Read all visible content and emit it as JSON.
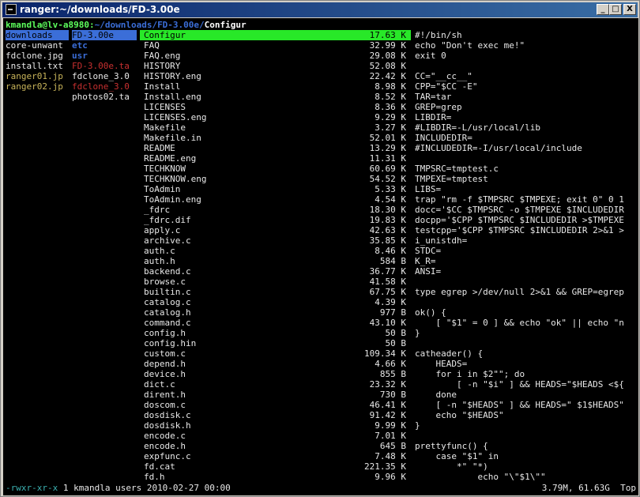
{
  "window": {
    "title": "ranger:~/downloads/FD-3.00e",
    "min": "_",
    "max": "□",
    "close": "X"
  },
  "header": {
    "user": "kmandla@lv-a8980:",
    "path": "~/downloads/FD-3.00e/",
    "file": "Configur"
  },
  "col1": [
    {
      "name": "downloads",
      "style": "sel-blue"
    },
    {
      "name": "core-unwant",
      "style": "white"
    },
    {
      "name": "fdclone.jpg",
      "style": "white"
    },
    {
      "name": "install.txt",
      "style": "white"
    },
    {
      "name": "ranger01.jp",
      "style": "yellow"
    },
    {
      "name": "ranger02.jp",
      "style": "yellow"
    }
  ],
  "col2": [
    {
      "name": "FD-3.00e",
      "style": "sel-blue"
    },
    {
      "name": "etc",
      "style": "blue"
    },
    {
      "name": "usr",
      "style": "blue"
    },
    {
      "name": "FD-3.00e.ta",
      "style": "red"
    },
    {
      "name": "fdclone_3.0",
      "style": "white"
    },
    {
      "name": "fdclone_3.0",
      "style": "red"
    },
    {
      "name": "photos02.ta",
      "style": "white"
    }
  ],
  "files": [
    {
      "name": "Configur",
      "size": "17.63 K"
    },
    {
      "name": "FAQ",
      "size": "32.99 K"
    },
    {
      "name": "FAQ.eng",
      "size": "29.08 K"
    },
    {
      "name": "HISTORY",
      "size": "52.08 K"
    },
    {
      "name": "HISTORY.eng",
      "size": "22.42 K"
    },
    {
      "name": "Install",
      "size": "8.98 K"
    },
    {
      "name": "Install.eng",
      "size": "8.52 K"
    },
    {
      "name": "LICENSES",
      "size": "8.36 K"
    },
    {
      "name": "LICENSES.eng",
      "size": "9.29 K"
    },
    {
      "name": "Makefile",
      "size": "3.27 K"
    },
    {
      "name": "Makefile.in",
      "size": "52.01 K"
    },
    {
      "name": "README",
      "size": "13.29 K"
    },
    {
      "name": "README.eng",
      "size": "11.31 K"
    },
    {
      "name": "TECHKNOW",
      "size": "60.69 K"
    },
    {
      "name": "TECHKNOW.eng",
      "size": "54.52 K"
    },
    {
      "name": "ToAdmin",
      "size": "5.33 K"
    },
    {
      "name": "ToAdmin.eng",
      "size": "4.54 K"
    },
    {
      "name": "_fdrc",
      "size": "18.30 K"
    },
    {
      "name": "_fdrc.dif",
      "size": "19.83 K"
    },
    {
      "name": "apply.c",
      "size": "42.63 K"
    },
    {
      "name": "archive.c",
      "size": "35.85 K"
    },
    {
      "name": "auth.c",
      "size": "8.46 K"
    },
    {
      "name": "auth.h",
      "size": "584 B"
    },
    {
      "name": "backend.c",
      "size": "36.77 K"
    },
    {
      "name": "browse.c",
      "size": "41.58 K"
    },
    {
      "name": "builtin.c",
      "size": "67.75 K"
    },
    {
      "name": "catalog.c",
      "size": "4.39 K"
    },
    {
      "name": "catalog.h",
      "size": "977 B"
    },
    {
      "name": "command.c",
      "size": "43.10 K"
    },
    {
      "name": "config.h",
      "size": "50 B"
    },
    {
      "name": "config.hin",
      "size": "50 B"
    },
    {
      "name": "custom.c",
      "size": "109.34 K"
    },
    {
      "name": "depend.h",
      "size": "4.66 K"
    },
    {
      "name": "device.h",
      "size": "855 B"
    },
    {
      "name": "dict.c",
      "size": "23.32 K"
    },
    {
      "name": "dirent.h",
      "size": "730 B"
    },
    {
      "name": "doscom.c",
      "size": "46.41 K"
    },
    {
      "name": "dosdisk.c",
      "size": "91.42 K"
    },
    {
      "name": "dosdisk.h",
      "size": "9.99 K"
    },
    {
      "name": "encode.c",
      "size": "7.01 K"
    },
    {
      "name": "encode.h",
      "size": "645 B"
    },
    {
      "name": "expfunc.c",
      "size": "7.48 K"
    },
    {
      "name": "fd.cat",
      "size": "221.35 K"
    },
    {
      "name": "fd.h",
      "size": "9.96 K"
    }
  ],
  "preview": [
    "#!/bin/sh",
    "echo \"Don't exec me!\"",
    "exit 0",
    "",
    "CC=\"__cc__\"",
    "CPP=\"$CC -E\"",
    "TAR=tar",
    "GREP=grep",
    "LIBDIR=",
    "#LIBDIR=-L/usr/local/lib",
    "INCLUDEDIR=",
    "#INCLUDEDIR=-I/usr/local/include",
    "",
    "TMPSRC=tmptest.c",
    "TMPEXE=tmptest",
    "LIBS=",
    "trap \"rm -f $TMPSRC $TMPEXE; exit 0\" 0 1",
    "docc='$CC $TMPSRC -o $TMPEXE $INCLUDEDIR",
    "docpp='$CPP $TMPSRC $INCLUDEDIR >$TMPEXE",
    "testcpp='$CPP $TMPSRC $INCLUDEDIR 2>&1 >",
    "i_unistdh=",
    "STDC=",
    "K_R=",
    "ANSI=",
    "",
    "type egrep >/dev/null 2>&1 && GREP=egrep",
    "",
    "ok() {",
    "    [ \"$1\" = 0 ] && echo \"ok\" || echo \"n",
    "}",
    "",
    "catheader() {",
    "    HEADS=",
    "    for i in $2\"\"; do",
    "        [ -n \"$i\" ] && HEADS=\"$HEADS <${",
    "    done",
    "    [ -n \"$HEADS\" ] && HEADS=\" $1$HEADS\"",
    "    echo \"$HEADS\"",
    "}",
    "",
    "prettyfunc() {",
    "    case \"$1\" in",
    "        *\" \"*)",
    "            echo \"\\\"$1\\\"\""
  ],
  "status": {
    "perm": "-rwxr-xr-x",
    "info": " 1 kmandla users 2010-02-27 00:00",
    "right": "3.79M, 61.63G  Top"
  }
}
